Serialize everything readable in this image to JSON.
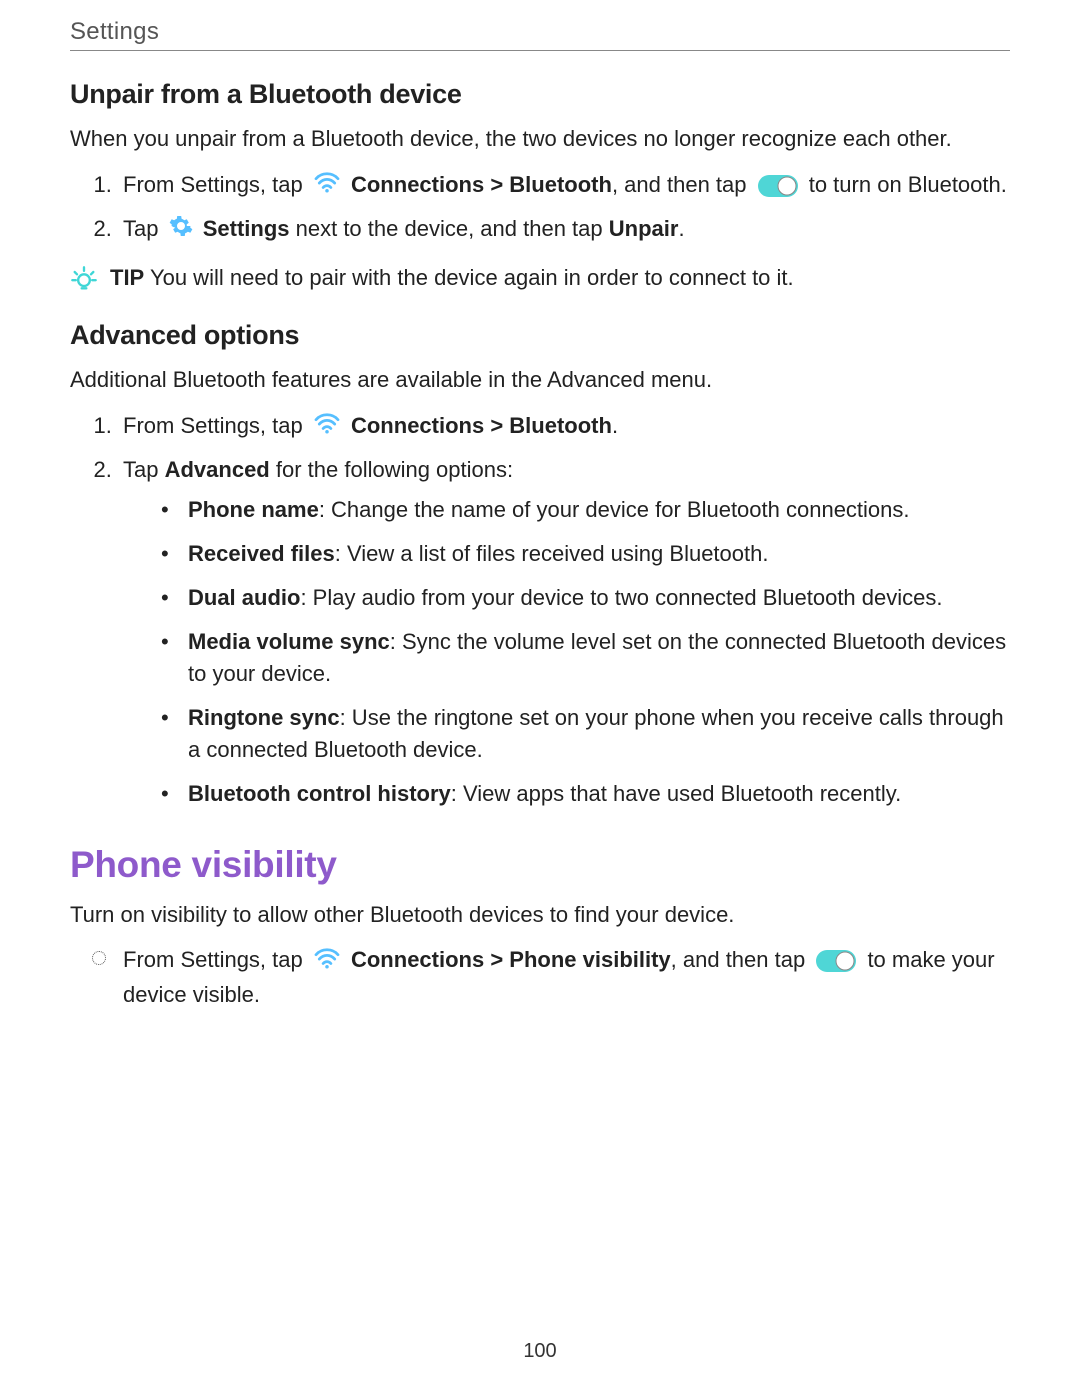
{
  "header": "Settings",
  "section_unpair": {
    "title": "Unpair from a Bluetooth device",
    "intro": "When you unpair from a Bluetooth device, the two devices no longer recognize each other.",
    "step1_a": "From Settings, tap ",
    "step1_b": "Connections > Bluetooth",
    "step1_c": ", and then tap ",
    "step1_d": " to turn on Bluetooth.",
    "step2_a": "Tap ",
    "step2_b": "Settings",
    "step2_c": " next to the device, and then tap ",
    "step2_d": "Unpair",
    "step2_e": ".",
    "tip_label": "TIP",
    "tip_text": "  You will need to pair with the device again in order to connect to it."
  },
  "section_adv": {
    "title": "Advanced options",
    "intro": "Additional Bluetooth features are available in the Advanced menu.",
    "step1_a": "From Settings, tap ",
    "step1_b": "Connections > Bluetooth",
    "step1_c": ".",
    "step2_a": "Tap ",
    "step2_b": "Advanced",
    "step2_c": " for the following options:",
    "opts": [
      {
        "label": "Phone name",
        "desc": ": Change the name of your device for Bluetooth connections."
      },
      {
        "label": "Received files",
        "desc": ": View a list of files received using Bluetooth."
      },
      {
        "label": "Dual audio",
        "desc": ": Play audio from your device to two connected Bluetooth devices."
      },
      {
        "label": "Media volume sync",
        "desc": ": Sync the volume level set on the connected Bluetooth devices to your device."
      },
      {
        "label": "Ringtone sync",
        "desc": ": Use the ringtone set on your phone when you receive calls through a connected Bluetooth device."
      },
      {
        "label": "Bluetooth control history",
        "desc": ": View apps that have used Bluetooth recently."
      }
    ]
  },
  "section_vis": {
    "title": "Phone visibility",
    "intro": "Turn on visibility to allow other Bluetooth devices to find your device.",
    "step_a": "From Settings, tap ",
    "step_b": "Connections > Phone visibility",
    "step_c": ", and then tap ",
    "step_d": " to make your device visible."
  },
  "page_number": "100"
}
